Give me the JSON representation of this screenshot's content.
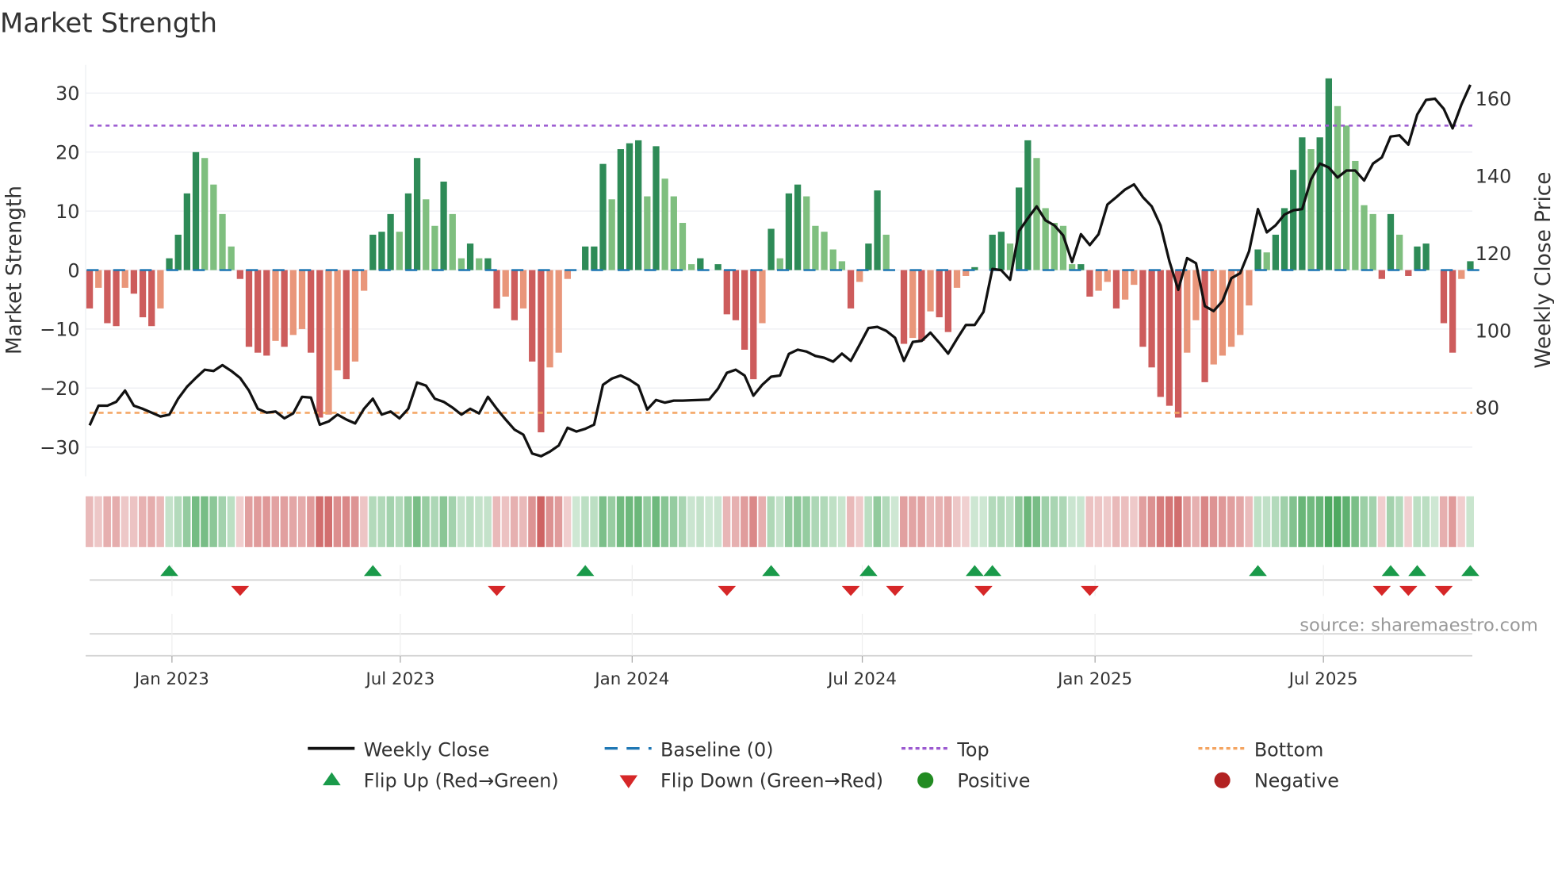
{
  "title": "Market Strength",
  "source": "source: sharemaestro.com",
  "colors": {
    "green_dark": "#2e8b57",
    "green_light": "#7fbf7f",
    "red_dark": "#cd5c5c",
    "red_light": "#e9967a",
    "baseline": "#1f77b4",
    "top": "#9b59d0",
    "bottom": "#f4a460",
    "flip_up": "#1a9a4a",
    "flip_down": "#d62728",
    "positive": "#228b22",
    "negative": "#b22222",
    "price": "#111111"
  },
  "chart_data": {
    "type": "bar",
    "title": "Market Strength",
    "ylabel": "Market Strength",
    "y2label": "Weekly Close Price",
    "ylim": [
      -35,
      33
    ],
    "y2lim": [
      62,
      170
    ],
    "yticks": [
      -30,
      -20,
      -10,
      0,
      10,
      20,
      30
    ],
    "yticklabels": [
      "−30",
      "−20",
      "−10",
      "0",
      "10",
      "20",
      "30"
    ],
    "y2ticks": [
      80,
      100,
      120,
      140,
      160
    ],
    "y2ticklabels": [
      "80",
      "100",
      "120",
      "140",
      "160"
    ],
    "top_level": 24.5,
    "bottom_level": -24.2,
    "xticks": [
      {
        "label": "Jan 2023",
        "week": 9.3
      },
      {
        "label": "Jul 2023",
        "week": 35.1
      },
      {
        "label": "Jan 2024",
        "week": 61.3
      },
      {
        "label": "Jul 2024",
        "week": 87.3
      },
      {
        "label": "Jan 2025",
        "week": 113.6
      },
      {
        "label": "Jul 2025",
        "week": 139.4
      }
    ],
    "strength": [
      -6.5,
      -3,
      -9,
      -9.5,
      -3,
      -4,
      -8,
      -9.5,
      -6.5,
      2,
      6,
      13,
      20,
      19,
      14.5,
      9.5,
      4,
      -1.5,
      -13,
      -14,
      -14.5,
      -12,
      -13,
      -11,
      -10,
      -14,
      -25,
      -24.5,
      -17,
      -18.5,
      -15.5,
      -3.5,
      6,
      6.5,
      9.5,
      6.5,
      13,
      19,
      12,
      7.5,
      15,
      9.5,
      2,
      4.5,
      2,
      2,
      -6.5,
      -4.5,
      -8.5,
      -6.5,
      -15.5,
      -27.5,
      -16.5,
      -14,
      -1.5,
      0,
      4,
      4,
      18,
      12,
      20.5,
      21.5,
      22,
      12.5,
      21,
      15.5,
      12.5,
      8,
      1,
      2,
      0,
      1,
      -7.5,
      -8.5,
      -13.5,
      -18.5,
      -9,
      7,
      2,
      13,
      14.5,
      12.5,
      7.5,
      6.5,
      3.5,
      1.5,
      -6.5,
      -2,
      4.5,
      13.5,
      6,
      0,
      -12.5,
      -11.5,
      -12,
      -7,
      -8,
      -10.5,
      -3,
      -1,
      0.5,
      0,
      6,
      6.5,
      4.5,
      14,
      22,
      19,
      10.5,
      8,
      7.5,
      1,
      1,
      -4.5,
      -3.5,
      -2,
      -6.5,
      -5,
      -2.5,
      -13,
      -16.5,
      -21.5,
      -23,
      -25,
      -14,
      -8.5,
      -19,
      -16,
      -14.5,
      -13,
      -11,
      -6,
      3.5,
      3,
      6,
      10.5,
      17,
      22.5,
      20.5,
      22.5,
      32.5,
      27.8,
      24.5,
      18.5,
      11,
      9.5,
      -1.5,
      9.5,
      6,
      -1,
      4,
      4.5,
      0,
      -9,
      -14,
      -1.5,
      1.5
    ],
    "weekly_close": [
      75.4,
      80.5,
      80.5,
      81.5,
      84.4,
      80.5,
      79.7,
      78.7,
      77.7,
      78.2,
      82.3,
      85.4,
      87.7,
      89.8,
      89.5,
      91,
      89.5,
      87.7,
      84.4,
      79.7,
      78.7,
      79,
      77.2,
      78.5,
      82.8,
      82.6,
      75.6,
      76.4,
      78.2,
      76.9,
      75.9,
      79.7,
      82.3,
      78.2,
      79,
      77.2,
      79.7,
      86.5,
      85.7,
      82.3,
      81.5,
      80,
      78.2,
      79.7,
      78.5,
      82.8,
      79.7,
      76.9,
      74.3,
      73,
      68.1,
      67.4,
      68.6,
      70.2,
      74.8,
      73.8,
      74.5,
      75.6,
      85.9,
      87.5,
      88.3,
      87.2,
      85.7,
      79.5,
      82,
      81.3,
      81.8,
      81.8,
      81.9,
      82,
      82.1,
      84.9,
      89,
      89.8,
      88.3,
      83.1,
      85.9,
      88,
      88.3,
      93.9,
      95,
      94.5,
      93.4,
      92.9,
      91.9,
      94,
      92.1,
      96.3,
      100.6,
      100.9,
      99.9,
      98.1,
      92.1,
      97,
      97.3,
      99.4,
      96.8,
      94,
      97.8,
      101.4,
      101.4,
      104.8,
      115.9,
      115.6,
      113.1,
      125.7,
      129,
      132.1,
      128.5,
      127.2,
      124.6,
      117.7,
      124.9,
      122.1,
      124.9,
      132.6,
      134.5,
      136.5,
      137.8,
      134.5,
      132.1,
      127.2,
      117.9,
      110.5,
      118.7,
      117.4,
      106.3,
      105,
      107.6,
      113.5,
      114.8,
      120.5,
      131.4,
      125.4,
      127.2,
      130,
      131.1,
      131.4,
      139.1,
      143.2,
      142.2,
      139.6,
      141.4,
      141.4,
      138.8,
      143.2,
      144.8,
      150.2,
      150.5,
      148.1,
      155.9,
      159.7,
      160,
      157.4,
      152.3,
      158.5,
      163.6
    ],
    "flip_up_weeks": [
      9,
      32,
      56,
      77,
      88,
      100,
      102,
      132,
      147,
      150,
      156
    ],
    "flip_down_weeks": [
      17,
      46,
      72,
      86,
      91,
      101,
      113,
      146,
      149,
      153
    ]
  },
  "legend": {
    "weekly_close": "Weekly Close",
    "baseline": "Baseline (0)",
    "top": "Top",
    "bottom": "Bottom",
    "flip_up": "Flip Up (Red→Green)",
    "flip_down": "Flip Down (Green→Red)",
    "positive": "Positive",
    "negative": "Negative"
  }
}
